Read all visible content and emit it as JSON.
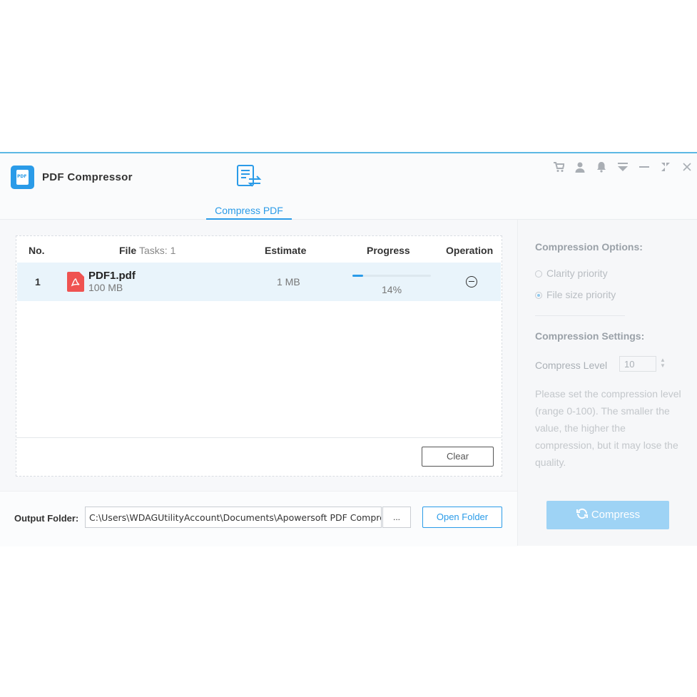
{
  "app": {
    "title": "PDF Compressor",
    "logo_text": "PDF"
  },
  "tabs": [
    {
      "label": "Compress PDF",
      "active": true
    }
  ],
  "window_controls": [
    "cart-icon",
    "user-icon",
    "bell-icon",
    "menu-icon",
    "minimize-icon",
    "restore-icon",
    "close-icon"
  ],
  "table": {
    "headers": {
      "no": "No.",
      "file": "File",
      "tasks": "Tasks: 1",
      "estimate": "Estimate",
      "progress": "Progress",
      "operation": "Operation"
    },
    "rows": [
      {
        "no": "1",
        "name": "PDF1.pdf",
        "size": "100 MB",
        "estimate": "1 MB",
        "progress_text": "14%",
        "progress": 0.14
      }
    ],
    "clear_label": "Clear"
  },
  "output": {
    "label": "Output Folder:",
    "path": "C:\\Users\\WDAGUtilityAccount\\Documents\\Apowersoft PDF Compres...",
    "browse_label": "...",
    "open_label": "Open Folder"
  },
  "options": {
    "heading": "Compression Options:",
    "clarity_label": "Clarity priority",
    "filesize_label": "File size priority",
    "selected": "File size priority"
  },
  "settings": {
    "heading": "Compression Settings:",
    "level_label": "Compress Level",
    "level_value": "10",
    "description": "Please set the compression level (range 0-100). The smaller the value, the higher the compression, but it may lose the quality."
  },
  "compress_label": "Compress",
  "colors": {
    "accent": "#2a9be8",
    "pdf_red": "#ef5351",
    "compress_disabled": "#9ed3f5"
  }
}
